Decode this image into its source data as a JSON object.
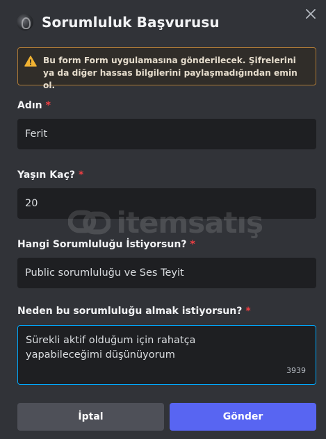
{
  "modal": {
    "title": "Sorumluluk Başvurusu",
    "warning": "Bu form Form uygulamasına gönderilecek. Şifrelerini ya da diğer hassas bilgilerini paylaşmadığından emin ol."
  },
  "fields": [
    {
      "label": "Adın",
      "required_mark": "*",
      "value": "Ferit"
    },
    {
      "label": "Yaşın Kaç?",
      "required_mark": "*",
      "value": "20"
    },
    {
      "label": "Hangi Sorumluluğu İstiyorsun?",
      "required_mark": "*",
      "value": "Public sorumluluğu ve Ses Teyit"
    },
    {
      "label": "Neden bu sorumluluğu almak istiyorsun?",
      "required_mark": "*",
      "value": "Sürekli aktif olduğum için rahatça yapabileceğimi düşünüyorum",
      "remaining_chars": "3939"
    }
  ],
  "buttons": {
    "cancel": "İptal",
    "submit": "Gönder"
  },
  "watermark": {
    "text": "itemsatış"
  },
  "icons": {
    "close": "close-icon",
    "warning": "warning-icon",
    "avatar": "app-avatar"
  },
  "colors": {
    "background": "#313338",
    "input_bg": "#1e1f22",
    "accent": "#5865f2",
    "focus_border": "#00a8fc",
    "required": "#f23f43",
    "warning_border": "#ad7a37"
  }
}
